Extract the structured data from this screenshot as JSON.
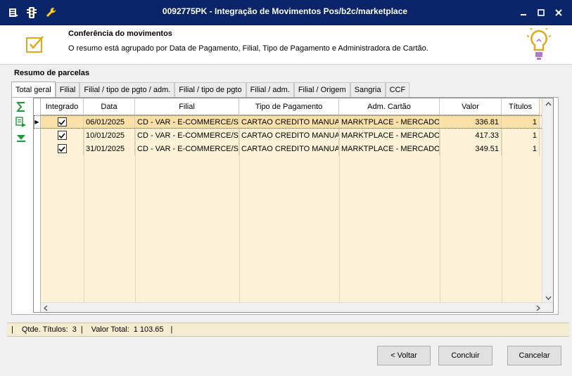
{
  "window": {
    "title": "0092775PK - Integração de Movimentos Pos/b2c/marketplace",
    "minimize": "_",
    "close": "✕"
  },
  "header": {
    "title": "Conferência do movimentos",
    "description": "O resumo está agrupado por Data de Pagamento, Filial, Tipo de Pagamento e Administradora de Cartão."
  },
  "section_title": "Resumo de parcelas",
  "tabs": [
    {
      "label": "Total geral",
      "active": true
    },
    {
      "label": "Filial"
    },
    {
      "label": "Filial / tipo de pgto / adm."
    },
    {
      "label": "Filial / tipo de pgto"
    },
    {
      "label": "Filial / adm."
    },
    {
      "label": "Filial / Origem"
    },
    {
      "label": "Sangria"
    },
    {
      "label": "CCF"
    }
  ],
  "grid": {
    "columns": [
      "Integrado",
      "Data",
      "Filial",
      "Tipo de Pagamento",
      "Adm. Cartão",
      "Valor",
      "Títulos"
    ],
    "rows": [
      {
        "integrado": true,
        "data": "06/01/2025",
        "filial": "CD - VAR - E-COMMERCE/SP",
        "tipo": "CARTAO CREDITO MANUAL",
        "adm": "MARKTPLACE - MERCADOLIV",
        "valor": "336.81",
        "titulos": "1",
        "selected": true
      },
      {
        "integrado": true,
        "data": "10/01/2025",
        "filial": "CD - VAR - E-COMMERCE/SP",
        "tipo": "CARTAO CREDITO MANUAL",
        "adm": "MARKTPLACE - MERCADOLIV",
        "valor": "417.33",
        "titulos": "1"
      },
      {
        "integrado": true,
        "data": "31/01/2025",
        "filial": "CD - VAR - E-COMMERCE/SP",
        "tipo": "CARTAO CREDITO MANUAL",
        "adm": "MARKTPLACE - MERCADOLIV",
        "valor": "349.51",
        "titulos": "1"
      }
    ]
  },
  "status": {
    "qtde_label": "Qtde. Títulos:",
    "qtde_value": "3",
    "valor_label": "Valor Total:",
    "valor_value": "1 103.65",
    "sep": "|"
  },
  "buttons": {
    "voltar": "< Voltar",
    "concluir": "Concluir",
    "cancelar": "Cancelar"
  },
  "colors": {
    "titlebar": "#0a246a",
    "grid_bg": "#fdf2d8",
    "selected_row": "#fbe0a8",
    "statusbar": "#f5edd2"
  }
}
